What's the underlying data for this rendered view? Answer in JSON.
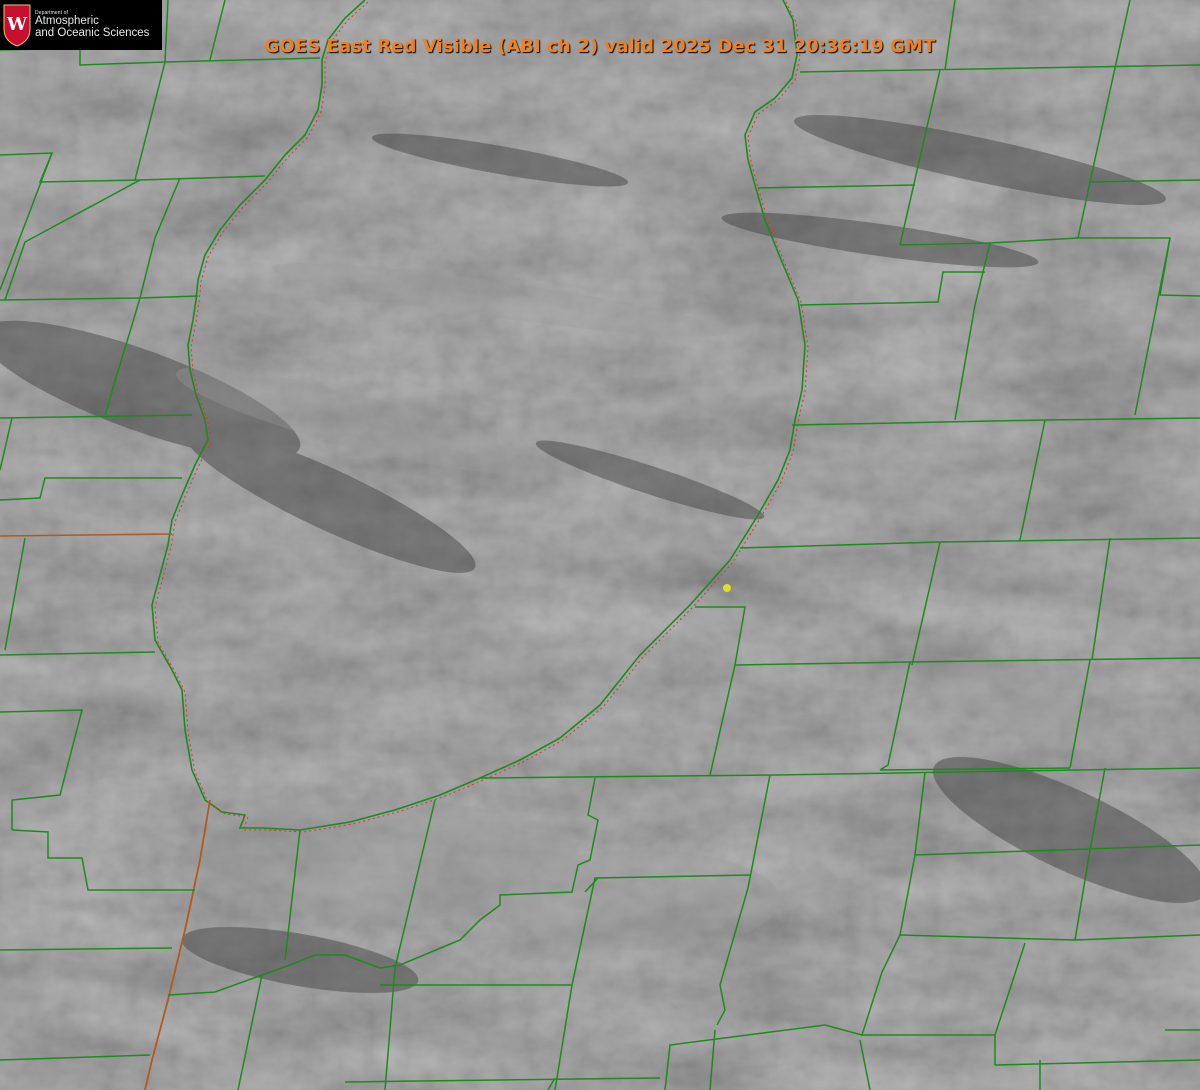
{
  "title": "GOES East Red Visible (ABI ch 2) valid 2025 Dec 31 20:36:19 GMT",
  "logo": {
    "department": "Department of",
    "line1": "Atmospheric",
    "line2": "and Oceanic Sciences",
    "seal_letter": "W"
  },
  "imagery": {
    "satellite": "GOES East",
    "channel": "ABI ch 2",
    "band": "Red Visible",
    "valid_time": "2025 Dec 31 20:36:19 GMT"
  },
  "colors": {
    "county_lines": "#1e8a1e",
    "coastline_dotted": "#d23a2a",
    "state_line": "#b25a1a",
    "title_text": "#f0801e",
    "marker": "#e0e020",
    "seal_red": "#c8102e",
    "cloud_base": "#6a6a6a"
  },
  "marker": {
    "name": "yellow-dot-marker",
    "color": "#e0e020"
  }
}
